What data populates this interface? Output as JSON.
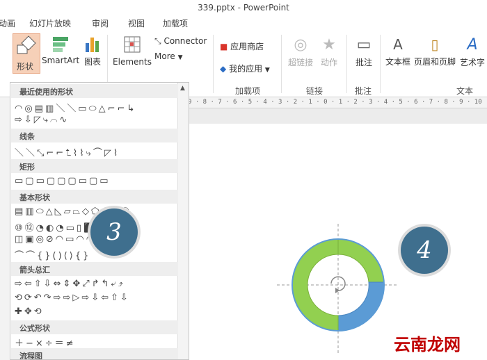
{
  "window": {
    "title": "339.pptx - PowerPoint"
  },
  "tabs": [
    "动画",
    "幻灯片放映",
    "审阅",
    "视图",
    "加载项"
  ],
  "ribbon": {
    "shapes_label": "形状",
    "smartart_label": "SmartArt",
    "chart_label": "图表",
    "elements_label": "Elements",
    "connector_label": "Connector",
    "more_label": "More",
    "app_store_label": "应用商店",
    "my_apps_label": "我的应用",
    "hyperlink_label": "超链接",
    "action_label": "动作",
    "comment_label": "批注",
    "textbox_label": "文本框",
    "header_footer_label": "页眉和页脚",
    "wordart_label": "艺术字",
    "groups": {
      "addins": "加载项",
      "links": "链接",
      "comments": "批注",
      "text": "文本"
    }
  },
  "ruler_text": "9 · 8 · 7 · 6 · 5 · 4 · 3 · 2 · 1 · 0 · 1 · 2 · 3 · 4 · 5 · 6 · 7 · 8 · 9 · 10",
  "panel": {
    "sections": [
      {
        "title": "最近使用的形状",
        "rows": [
          "◠◎▤▥＼＼▭⬭△⌐⌐↳",
          "⇨⇩◸⤷⌒∿"
        ]
      },
      {
        "title": "线条",
        "rows": [
          "＼＼⤡⌐⌐⮤⌇⌇⤷⌒◸⌇"
        ]
      },
      {
        "title": "矩形",
        "rows": [
          "▭▢▭▢▢▢▭▢▭"
        ]
      },
      {
        "title": "基本形状",
        "rows": [
          "▤▥⬭△◺▱⏢◇⬠⬡⑦⑧",
          "⑩⑫◔◐◔▭▯⬛╬✚⊕⌸",
          "◫▣◎⊘◠▭◠◠☼☾☁",
          "⌒⌒{}()⟨⟩{}"
        ]
      },
      {
        "title": "箭头总汇",
        "rows": [
          "⇨⇦⇧⇩⇔⇕✥⤢↱↰⤶⤴",
          "⟲⟳↶↷⇨⇨▷⇨⇩⇦⇧⇩",
          "✚✥⟲"
        ]
      },
      {
        "title": "公式形状",
        "rows": [
          "＋−×÷＝≠"
        ]
      },
      {
        "title": "流程图",
        "rows": []
      }
    ]
  },
  "badges": {
    "step3": "3",
    "step4": "4"
  },
  "watermark": "云南龙网",
  "colors": {
    "ring_green": "#92d050",
    "ring_blue": "#5b9bd5",
    "badge": "#3f6f8e",
    "watermark": "#c00000"
  }
}
